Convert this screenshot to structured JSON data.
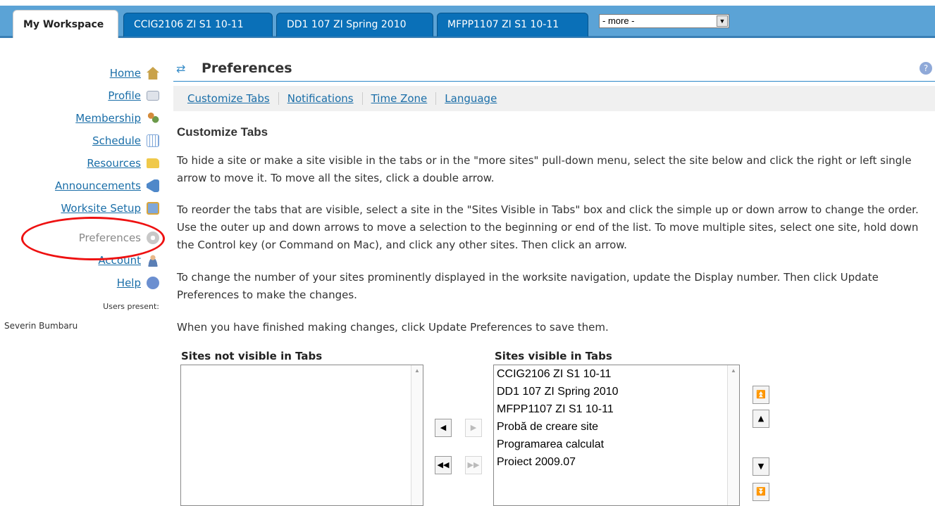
{
  "tabs": {
    "active": "My Workspace",
    "items": [
      "CCIG2106 ZI S1 10-11",
      "DD1 107 ZI Spring 2010",
      "MFPP1107 ZI S1 10-11"
    ],
    "more": "- more -"
  },
  "nav": {
    "items": [
      {
        "label": "Home",
        "icon": "home-icon",
        "color": "#c9a24a"
      },
      {
        "label": "Profile",
        "icon": "profile-card-icon",
        "color": "#9aa6b8"
      },
      {
        "label": "Membership",
        "icon": "membership-people-icon",
        "color": "#d48b3c"
      },
      {
        "label": "Schedule",
        "icon": "calendar-icon",
        "color": "#7fa7d9"
      },
      {
        "label": "Resources",
        "icon": "folder-icon",
        "color": "#f0c94a"
      },
      {
        "label": "Announcements",
        "icon": "megaphone-icon",
        "color": "#4f88c9"
      },
      {
        "label": "Worksite Setup",
        "icon": "worksite-setup-icon",
        "color": "#d9a53c"
      },
      {
        "label": "Preferences",
        "icon": "gear-icon",
        "color": "#c8c8c8"
      },
      {
        "label": "Account",
        "icon": "account-person-icon",
        "color": "#5b7fb5"
      },
      {
        "label": "Help",
        "icon": "help-icon",
        "color": "#6b8fd0"
      }
    ],
    "users_present_label": "Users present:",
    "user_name": "Severin Bumbaru"
  },
  "title": "Preferences",
  "subnav": [
    "Customize Tabs",
    "Notifications",
    "Time Zone",
    "Language"
  ],
  "heading": "Customize Tabs",
  "paragraphs": [
    "To hide a site or make a site visible in the tabs or in the \"more sites\" pull-down menu, select the site below and click the right or left single arrow to move it. To move all the sites, click a double arrow.",
    "To reorder the tabs that are visible, select a site in the \"Sites Visible in Tabs\" box and click the simple up or down arrow to change the order. Use the outer up and down arrows to move a selection to the beginning or end of the list. To move multiple sites, select one site, hold down the Control key (or Command on Mac), and click any other sites. Then click an arrow.",
    "To change the number of your sites prominently displayed in the worksite navigation, update the Display number. Then click Update Preferences to make the changes.",
    "When you have finished making changes, click Update Preferences to save them."
  ],
  "not_visible_label": "Sites not visible in Tabs",
  "visible_label": "Sites visible in Tabs",
  "visible_sites": [
    "CCIG2106 ZI S1 10-11",
    "DD1 107 ZI Spring 2010",
    "MFPP1107 ZI S1 10-11",
    "Probă de creare site",
    "Programarea calculat",
    "Proiect 2009.07"
  ],
  "colors": {
    "tab_band": "#5ba3d6",
    "tab": "#0a70b8",
    "link": "#1a6ea8",
    "highlight_ellipse": "#e11111"
  }
}
